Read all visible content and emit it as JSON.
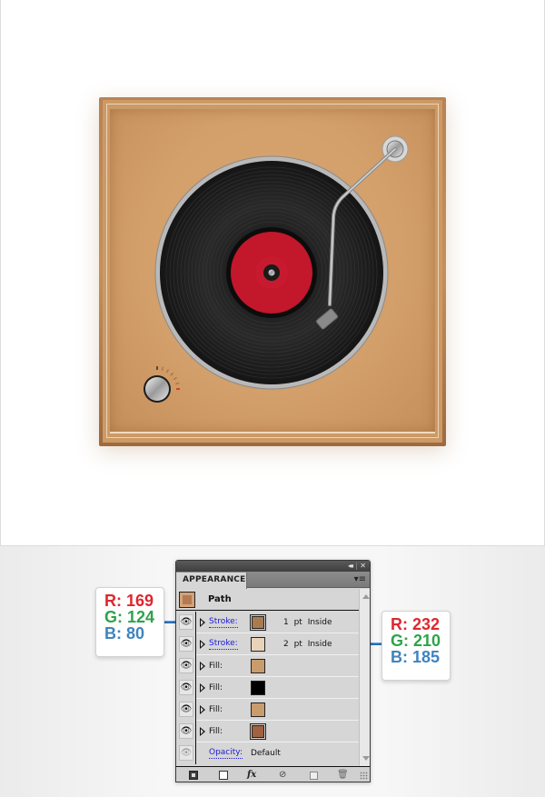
{
  "illustration": {
    "subject": "turntable-icon",
    "colors": {
      "wood_outer": "#a97c50",
      "wood_face": "#d39f6a",
      "highlight_line": "#e8d2b9",
      "vinyl": "#1a1a1a",
      "label": "#c3172b",
      "metal": "#b8b8b8"
    },
    "volume_ticks": 7
  },
  "panel": {
    "tab_label": "APPEARANCE",
    "collapse_glyph": "◂◂",
    "close_glyph": "✕",
    "menu_glyph": "▾≡",
    "header_label": "Path",
    "rows": [
      {
        "type": "Stroke:",
        "swatch": "#a97c50",
        "detail": "1 pt Inside",
        "link": true,
        "selected": true,
        "visible": true
      },
      {
        "type": "Stroke:",
        "swatch": "#e8d2b9",
        "detail": "2 pt Inside",
        "link": true,
        "selected": false,
        "visible": true
      },
      {
        "type": "Fill:",
        "swatch": "#c99c6e",
        "detail": "",
        "link": false,
        "selected": false,
        "visible": true
      },
      {
        "type": "Fill:",
        "swatch": "#000000",
        "detail": "",
        "link": false,
        "selected": false,
        "visible": true
      },
      {
        "type": "Fill:",
        "swatch": "#c99c6e",
        "detail": "",
        "link": false,
        "selected": false,
        "visible": true
      },
      {
        "type": "Fill:",
        "swatch": "#a0623f",
        "detail": "",
        "link": false,
        "selected": true,
        "visible": true
      }
    ],
    "opacity_label": "Opacity:",
    "opacity_value": "Default",
    "footer": {
      "fx_label": "fx",
      "clear_glyph": "⊘",
      "delete_glyph": "🗑"
    }
  },
  "callouts": {
    "left": {
      "r": "R: 169",
      "g": "G: 124",
      "b": "B: 80"
    },
    "right": {
      "r": "R: 232",
      "g": "G: 210",
      "b": "B: 185"
    }
  }
}
